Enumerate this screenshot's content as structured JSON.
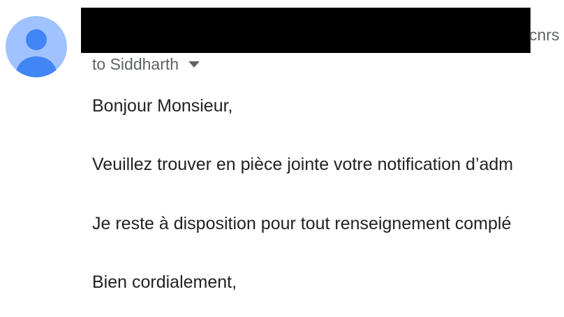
{
  "email": {
    "sender_visible_suffix": "cnrs",
    "recipient": "to Siddharth",
    "body": {
      "greeting": "Bonjour Monsieur,",
      "line1": "Veuillez trouver en pièce jointe votre notification d’adm",
      "line2": "Je reste à disposition pour tout renseignement complé",
      "closing": "Bien cordialement,"
    }
  },
  "colors": {
    "avatar_bg": "#a0c3ff",
    "avatar_figure": "#4285f4",
    "redaction": "#000000",
    "muted_text": "#5f6368",
    "body_text": "#222222"
  },
  "icons": {
    "avatar": "person-icon",
    "recipient_toggle": "caret-down-icon"
  }
}
